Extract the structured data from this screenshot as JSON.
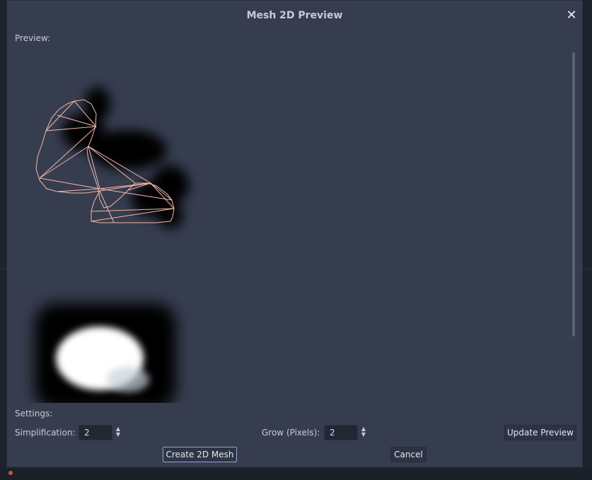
{
  "dialog": {
    "title": "Mesh 2D Preview",
    "close_icon": "close-icon",
    "preview_label": "Preview:",
    "settings_label": "Settings:",
    "simplification_label": "Simplification:",
    "simplification_value": "2",
    "grow_label": "Grow (Pixels):",
    "grow_value": "2",
    "update_preview_label": "Update Preview",
    "create_label": "Create 2D Mesh",
    "cancel_label": "Cancel"
  },
  "colors": {
    "dialog_bg": "#363d4f",
    "mesh_wire": "#f2b8a8",
    "focus_border": "#8fa8d8"
  }
}
